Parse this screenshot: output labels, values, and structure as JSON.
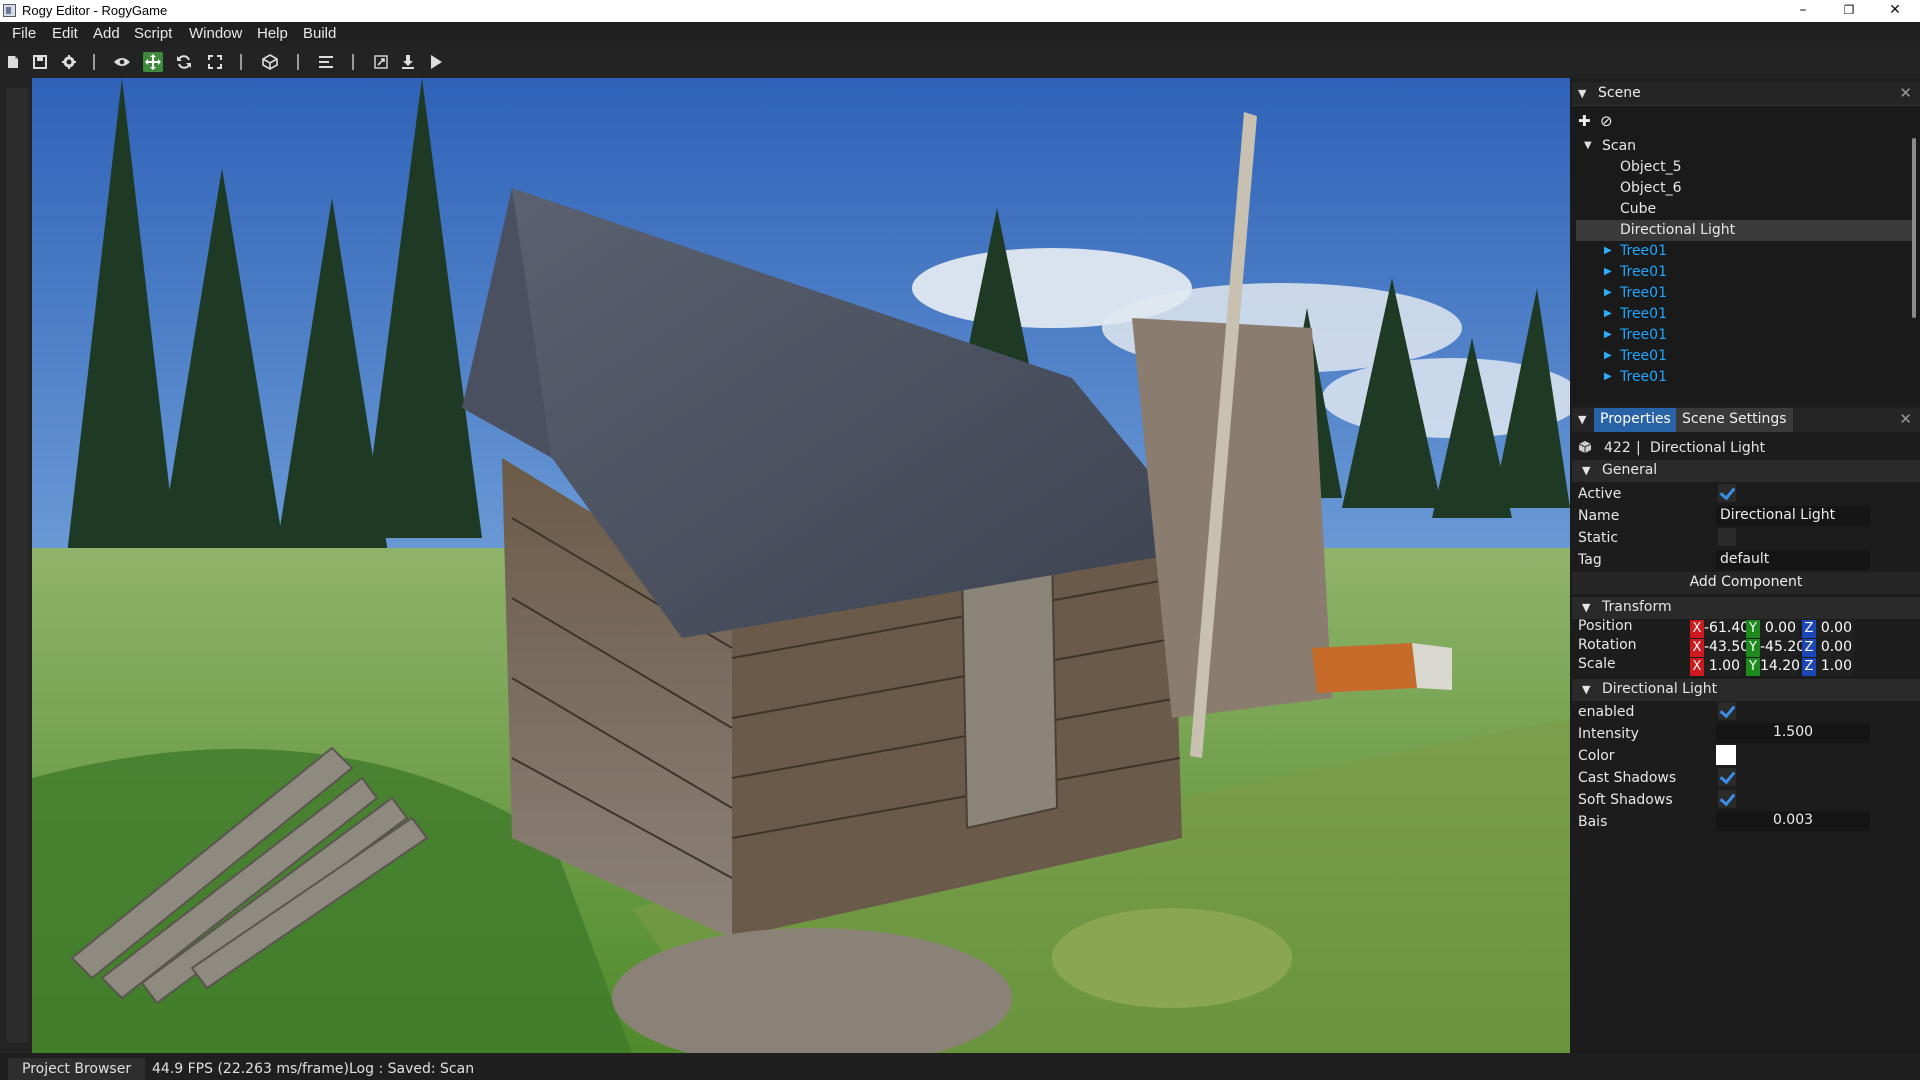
{
  "window": {
    "title": "Rogy Editor - RogyGame",
    "controls": {
      "minimize": "–",
      "maximize": "❐",
      "close": "✕"
    }
  },
  "menu": [
    "File",
    "Edit",
    "Add",
    "Script",
    "Window",
    "Help",
    "Build"
  ],
  "toolbar": {
    "buttons": [
      "new-file-icon",
      "save-icon",
      "settings-icon",
      "eye-icon",
      "move-icon",
      "rotate-icon",
      "scale-icon",
      "cube-icon",
      "align-icon",
      "expand-icon",
      "export-icon",
      "play-icon"
    ],
    "active": "move-icon",
    "accent": "#3d8a3d"
  },
  "scene": {
    "title": "Scene",
    "root": "Scan",
    "children": [
      "Object_5",
      "Object_6",
      "Cube",
      "Directional Light"
    ],
    "selected": "Directional Light",
    "prefabs": [
      "Tree01",
      "Tree01",
      "Tree01",
      "Tree01",
      "Tree01",
      "Tree01",
      "Tree01"
    ],
    "prefab_color": "#1fa6ff"
  },
  "properties": {
    "tabs": [
      "Properties",
      "Scene Settings"
    ],
    "active_tab": "Properties",
    "object_id": "422",
    "object_sep": "|",
    "object_name": "Directional Light",
    "general": {
      "section": "General",
      "active_label": "Active",
      "active": true,
      "name_label": "Name",
      "name_value": "Directional Light",
      "static_label": "Static",
      "static": false,
      "tag_label": "Tag",
      "tag_value": "default",
      "add_component": "Add Component"
    },
    "transform": {
      "section": "Transform",
      "position_label": "Position",
      "rotation_label": "Rotation",
      "scale_label": "Scale",
      "axis_x": "X",
      "axis_y": "Y",
      "axis_z": "Z",
      "position": [
        "-61.40",
        "0.00",
        "0.00"
      ],
      "rotation": [
        "-43.50",
        "-45.20",
        "0.00"
      ],
      "scale": [
        "1.00",
        "14.20",
        "1.00"
      ]
    },
    "light": {
      "section": "Directional Light",
      "enabled_label": "enabled",
      "enabled": true,
      "intensity_label": "Intensity",
      "intensity": "1.500",
      "color_label": "Color",
      "color": "#ffffff",
      "cast_shadows_label": "Cast Shadows",
      "cast_shadows": true,
      "soft_shadows_label": "Soft Shadows",
      "soft_shadows": true,
      "bais_label": "Bais",
      "bais": "0.003"
    }
  },
  "status": {
    "tab": "Project Browser",
    "fps": "44.9 FPS (22.263 ms/frame)",
    "log": "Log : Saved: Scan"
  }
}
